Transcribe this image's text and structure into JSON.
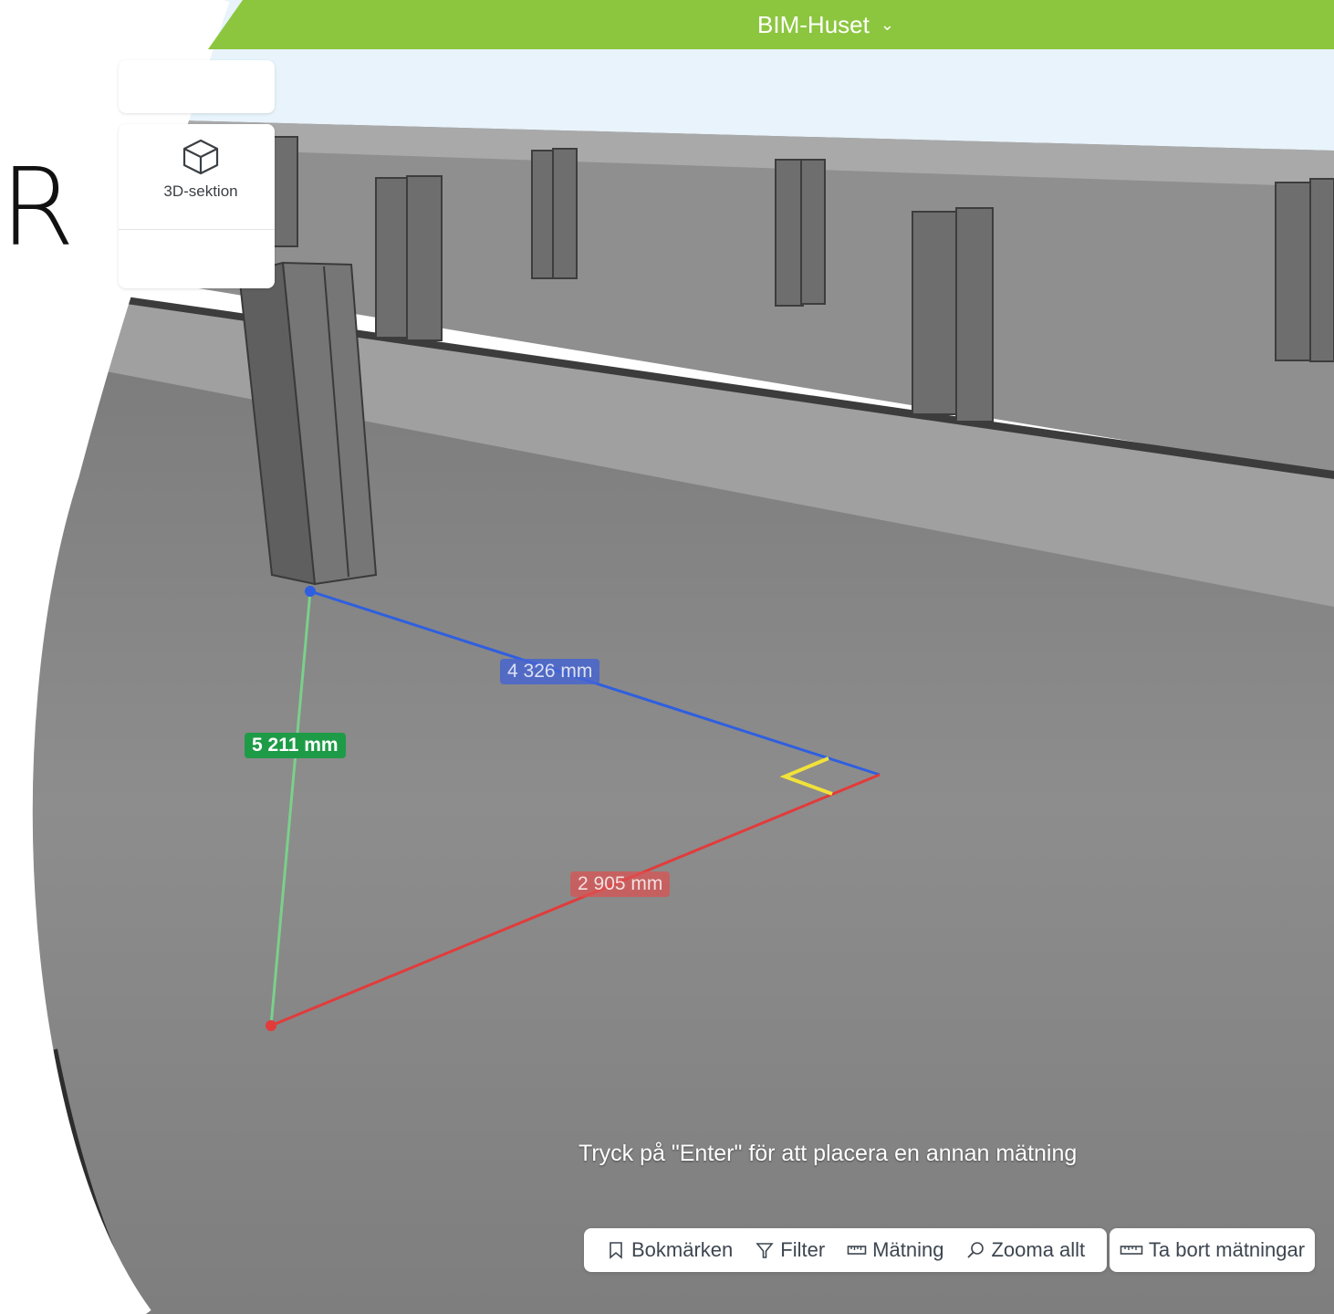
{
  "header": {
    "project_name": "BIM-Huset",
    "chevron_icon": "chevron-down-icon"
  },
  "slide_letter": "R",
  "left_panel": {
    "tool_label": "3D-sektion",
    "tool_icon": "cube-icon"
  },
  "measurements": {
    "green": {
      "label": "5 211 mm",
      "color": "#1e9b47"
    },
    "blue": {
      "label": "4 326 mm",
      "color": "#2f5fe0"
    },
    "red": {
      "label": "2 905 mm",
      "color": "#e23b3b"
    }
  },
  "hint": "Tryck på \"Enter\" för att placera en annan mätning",
  "toolbar": {
    "bookmarks": "Bokmärken",
    "filter": "Filter",
    "measure": "Mätning",
    "zoom_all": "Zooma allt",
    "remove_measurements": "Ta bort mätningar"
  },
  "colors": {
    "accent": "#8cc63f",
    "sky": "#e8f3fb",
    "floor": "#8a8a8a"
  }
}
